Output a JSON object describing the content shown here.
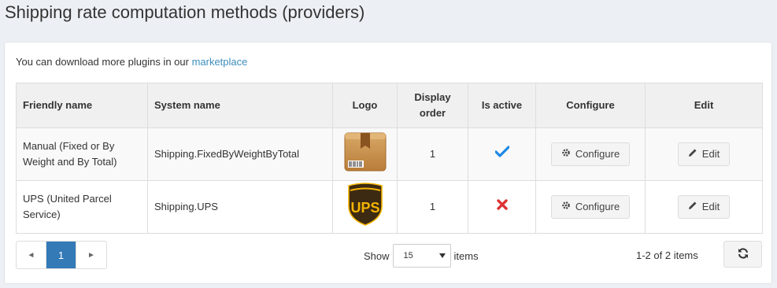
{
  "page": {
    "title": "Shipping rate computation methods (providers)"
  },
  "hint": {
    "text": "You can download more plugins in our ",
    "link": "marketplace"
  },
  "table": {
    "headers": {
      "friendly": "Friendly name",
      "system": "System name",
      "logo": "Logo",
      "display_order_1": "Display",
      "display_order_2": "order",
      "active": "Is active",
      "configure": "Configure",
      "edit": "Edit"
    },
    "rows": [
      {
        "friendly_1": "Manual (Fixed or By",
        "friendly_2": "Weight and By Total)",
        "system": "Shipping.FixedByWeightByTotal",
        "display_order": "1",
        "is_active": true,
        "logo_icon": "package-box-icon",
        "configure_label": "Configure",
        "edit_label": "Edit"
      },
      {
        "friendly_1": "UPS (United Parcel",
        "friendly_2": "Service)",
        "system": "Shipping.UPS",
        "display_order": "1",
        "is_active": false,
        "logo_icon": "ups-logo",
        "logo_text": "UPS",
        "configure_label": "Configure",
        "edit_label": "Edit"
      }
    ]
  },
  "pager": {
    "prev": "◄",
    "current": "1",
    "next": "►"
  },
  "page_size": {
    "show": "Show",
    "value": "15",
    "items": "items"
  },
  "info": "1-2 of 2 items",
  "colors": {
    "accent": "#3c8dbc",
    "active_check": "#1e88e5",
    "inactive_x": "#dd3333"
  }
}
